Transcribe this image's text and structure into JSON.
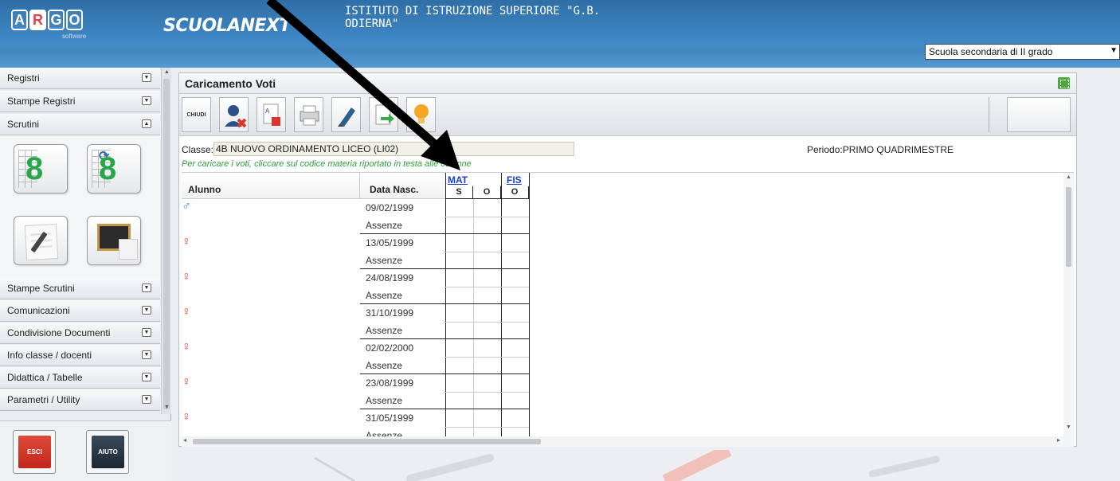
{
  "header": {
    "logo_letters": [
      "A",
      "R",
      "G",
      "O"
    ],
    "logo_sub": "software",
    "brand": "SCUOLANEXT",
    "school_name": "ISTITUTO DI ISTRUZIONE SUPERIORE \"G.B. ODIERNA\"",
    "school_type_selected": "Scuola secondaria di II grado"
  },
  "sidebar": {
    "items": [
      {
        "label": "Registri",
        "state": "collapsed"
      },
      {
        "label": "Stampe Registri",
        "state": "collapsed"
      },
      {
        "label": "Scrutini",
        "state": "expanded"
      },
      {
        "label": "Stampe Scrutini",
        "state": "collapsed"
      },
      {
        "label": "Comunicazioni",
        "state": "collapsed"
      },
      {
        "label": "Condivisione Documenti",
        "state": "collapsed"
      },
      {
        "label": "Info classe / docenti",
        "state": "collapsed"
      },
      {
        "label": "Didattica / Tabelle",
        "state": "collapsed"
      },
      {
        "label": "Parametri / Utility",
        "state": "collapsed"
      }
    ],
    "esci_label": "ESCI",
    "aiuto_label": "AIUTO"
  },
  "main": {
    "title": "Caricamento Voti",
    "chiudi_label": "CHIUDI",
    "class_label": "Classe:",
    "class_value": "4B NUOVO ORDINAMENTO LICEO (LI02)",
    "periodo": "Periodo:PRIMO QUADRIMESTRE",
    "hint": "Per caricare i voti, cliccare sul codice materia riportato in testa alle colonne"
  },
  "grid": {
    "col_alunno": "Alunno",
    "col_data": "Data Nasc.",
    "subjects": [
      {
        "code": "MAT",
        "sub_cols": [
          "S",
          "O"
        ]
      },
      {
        "code": "FIS",
        "sub_cols": [
          "O"
        ]
      }
    ],
    "absence_label": "Assenze",
    "rows": [
      {
        "gender": "M",
        "symbol": "♂",
        "birth": "09/02/1999"
      },
      {
        "gender": "F",
        "symbol": "♀",
        "birth": "13/05/1999"
      },
      {
        "gender": "F",
        "symbol": "♀",
        "birth": "24/08/1999"
      },
      {
        "gender": "F",
        "symbol": "♀",
        "birth": "31/10/1999"
      },
      {
        "gender": "F",
        "symbol": "♀",
        "birth": "02/02/2000"
      },
      {
        "gender": "F",
        "symbol": "♀",
        "birth": "23/08/1999"
      },
      {
        "gender": "F",
        "symbol": "♀",
        "birth": "31/05/1999"
      }
    ]
  }
}
